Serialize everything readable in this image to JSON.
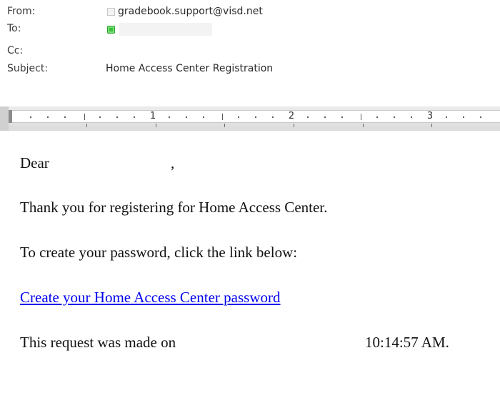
{
  "header": {
    "from_label": "From:",
    "from_value": "gradebook.support@visd.net",
    "to_label": "To:",
    "cc_label": "Cc:",
    "subject_label": "Subject:",
    "subject_value": "Home Access Center Registration"
  },
  "ruler": {
    "numbers": [
      "1",
      "2",
      "3"
    ]
  },
  "body": {
    "greeting": "Dear",
    "greeting_comma": ",",
    "thanks": "Thank you for registering for Home Access Center.",
    "instruction": "To create your password, click the link below:",
    "link_text": "Create your Home Access Center password",
    "request_prefix": "This request was made on",
    "request_time": "10:14:57 AM."
  },
  "icons": {
    "from_presence": "presence-unknown-icon",
    "to_presence": "presence-online-icon"
  },
  "colors": {
    "link": "#0000ee",
    "online_presence": "#3bbf3b"
  }
}
